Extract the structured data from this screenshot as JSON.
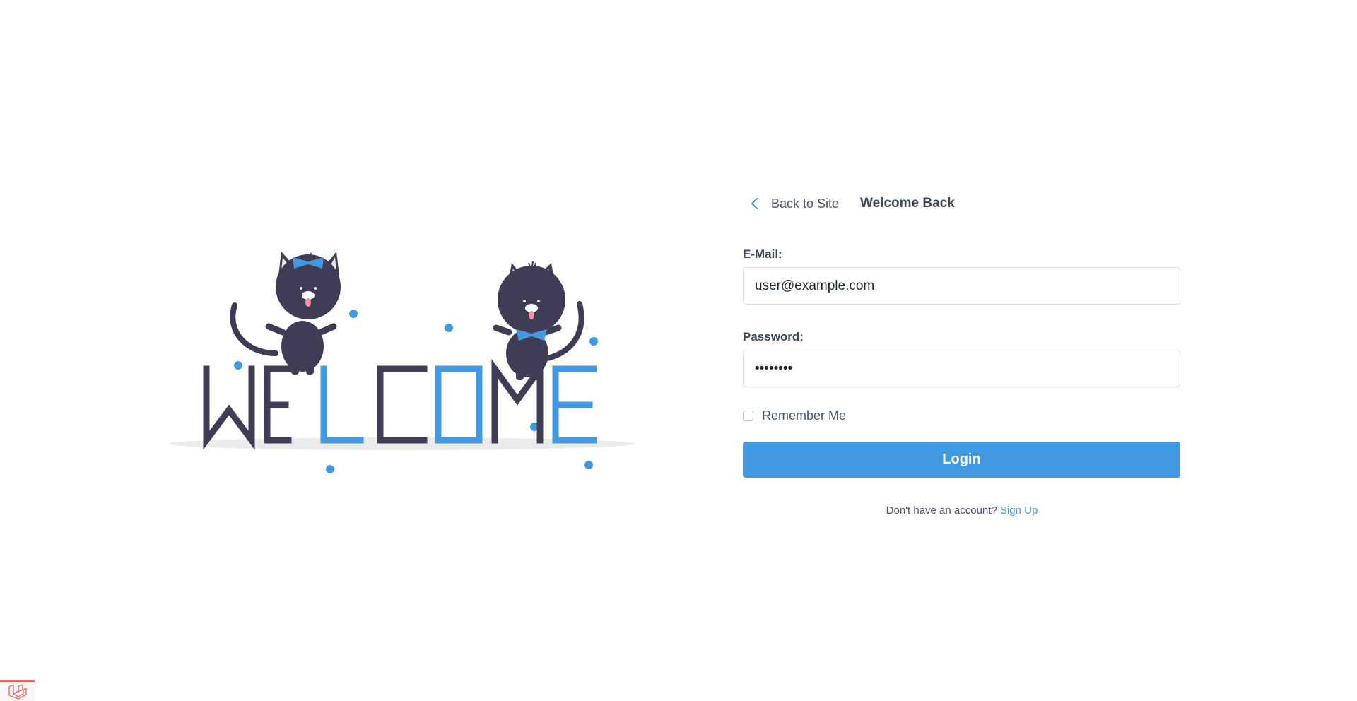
{
  "header": {
    "back_label": "Back to Site",
    "title": "Welcome Back"
  },
  "illustration": {
    "word": "WELCOME",
    "letter_colors": [
      "#3f3d56",
      "#3f3d56",
      "#4299e1",
      "#3f3d56",
      "#4299e1",
      "#3f3d56",
      "#4299e1"
    ]
  },
  "form": {
    "email_label": "E-Mail:",
    "email_value": "user@example.com",
    "password_label": "Password:",
    "password_value": "password",
    "remember_label": "Remember Me",
    "remember_checked": false,
    "submit_label": "Login"
  },
  "footer": {
    "prompt": "Don't have an account?",
    "signup_label": "Sign Up"
  },
  "colors": {
    "accent": "#4299e1",
    "dark": "#3f3d56",
    "text": "#3d4852"
  },
  "icons": {
    "back": "chevron-left-icon",
    "corner": "laravel-logo-icon"
  }
}
